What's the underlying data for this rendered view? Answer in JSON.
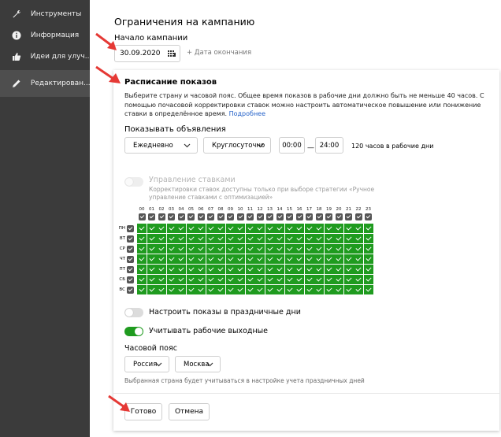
{
  "sidebar": {
    "items": [
      {
        "label": "Инструменты",
        "icon": "wrench-icon"
      },
      {
        "label": "Информация",
        "icon": "info-icon"
      },
      {
        "label": "Идеи для улуч...",
        "icon": "thumbs-up-icon"
      },
      {
        "label": "Редактирован...",
        "icon": "pencil-icon",
        "active": true
      }
    ]
  },
  "section": {
    "title": "Ограничения на кампанию",
    "start_label": "Начало кампании",
    "start_date": "30.09.2020",
    "end_date_link": "+ Дата окончания"
  },
  "schedule": {
    "title": "Расписание показов",
    "description": "Выберите страну и часовой пояс. Общее время показов в рабочие дни должно быть не меньше 40 часов. С помощью почасовой корректировки ставок можно настроить автоматическое повышение или понижение ставки в определённое время.",
    "more_link": "Подробнее",
    "show_ads_label": "Показывать объявления",
    "days_select": "Ежедневно",
    "hours_select": "Круглосуточно",
    "time_from": "00:00",
    "time_dash": "—",
    "time_to": "24:00",
    "hours_note": "120 часов в рабочие дни",
    "bid_mgmt_title": "Управление ставками",
    "bid_mgmt_desc": "Корректировки ставок доступны только при выборе стратегии «Ручное управление ставками с оптимизацией»",
    "hours": [
      "00",
      "01",
      "02",
      "03",
      "04",
      "05",
      "06",
      "07",
      "08",
      "09",
      "10",
      "11",
      "12",
      "13",
      "14",
      "15",
      "16",
      "17",
      "18",
      "19",
      "20",
      "21",
      "22",
      "23"
    ],
    "days": [
      "ПН",
      "ВТ",
      "СР",
      "ЧТ",
      "ПТ",
      "СБ",
      "ВС"
    ],
    "holidays_label": "Настроить показы в праздничные дни",
    "workdays_label": "Учитывать рабочие выходные",
    "timezone_label": "Часовой пояс",
    "country_select": "Россия",
    "city_select": "Москва",
    "timezone_note": "Выбранная страна будет учитываться в настройке учета праздничных дней",
    "done_button": "Готово",
    "cancel_button": "Отмена"
  },
  "colors": {
    "sidebar_bg": "#3b3b3b",
    "grid_green": "#1f9b1f",
    "arrow_red": "#e53935",
    "link_blue": "#2260c8"
  }
}
